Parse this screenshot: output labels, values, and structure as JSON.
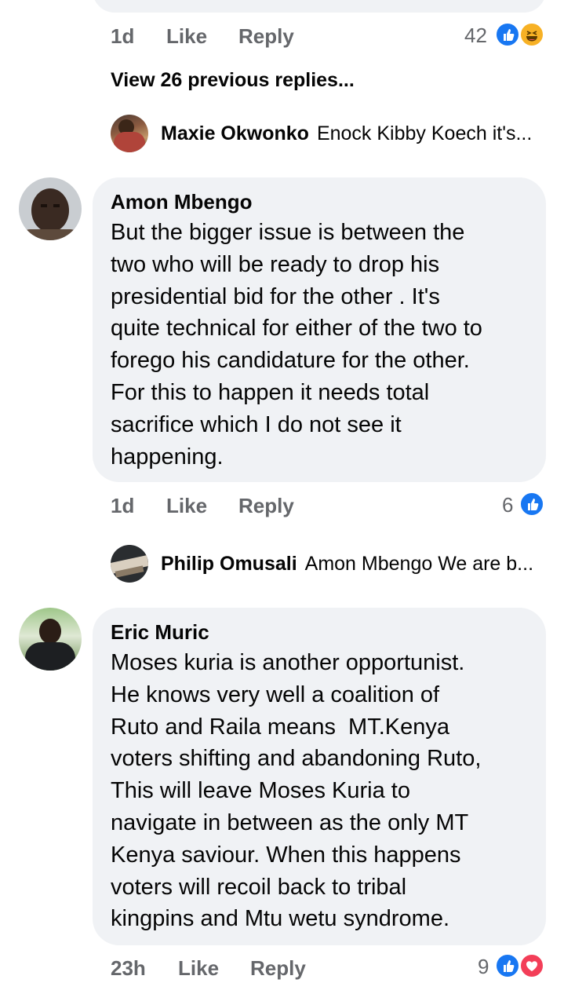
{
  "top_comment": {
    "time": "1d",
    "like_label": "Like",
    "reply_label": "Reply",
    "reaction_count": "42",
    "reactions": [
      "like-icon",
      "haha-icon"
    ]
  },
  "view_previous": "View 26 previous replies...",
  "reply1": {
    "author": "Maxie Okwonko",
    "snippet": "Enock Kibby Koech it's..."
  },
  "comment1": {
    "author": "Amon Mbengo",
    "lines": [
      "But the bigger issue is between the",
      "two who will be ready to drop his",
      "presidential bid for the other . It's",
      "quite technical for either of the two to",
      "forego his candidature for the other.",
      "For this to happen it needs total",
      "sacrifice which I do not see it",
      "happening."
    ],
    "time": "1d",
    "like_label": "Like",
    "reply_label": "Reply",
    "reaction_count": "6",
    "reactions": [
      "like-icon"
    ]
  },
  "reply2": {
    "author": "Philip Omusali",
    "snippet": "Amon Mbengo We are b..."
  },
  "comment2": {
    "author": "Eric Muric",
    "lines": [
      "Moses kuria is another opportunist.",
      "He knows very well a coalition of",
      "Ruto and Raila means  MT.Kenya",
      "voters shifting and abandoning Ruto,",
      "This will leave Moses Kuria to",
      "navigate in between as the only MT",
      "Kenya saviour. When this happens",
      "voters will recoil back to tribal",
      "kingpins and Mtu wetu syndrome."
    ],
    "time": "23h",
    "like_label": "Like",
    "reply_label": "Reply",
    "reaction_count": "9",
    "reactions": [
      "like-icon",
      "love-icon"
    ]
  },
  "colors": {
    "bubble": "#f0f2f5",
    "meta_text": "#65676b",
    "like_blue": "#1877f2",
    "love_red": "#f33e58",
    "haha_yellow": "#f7b125"
  }
}
